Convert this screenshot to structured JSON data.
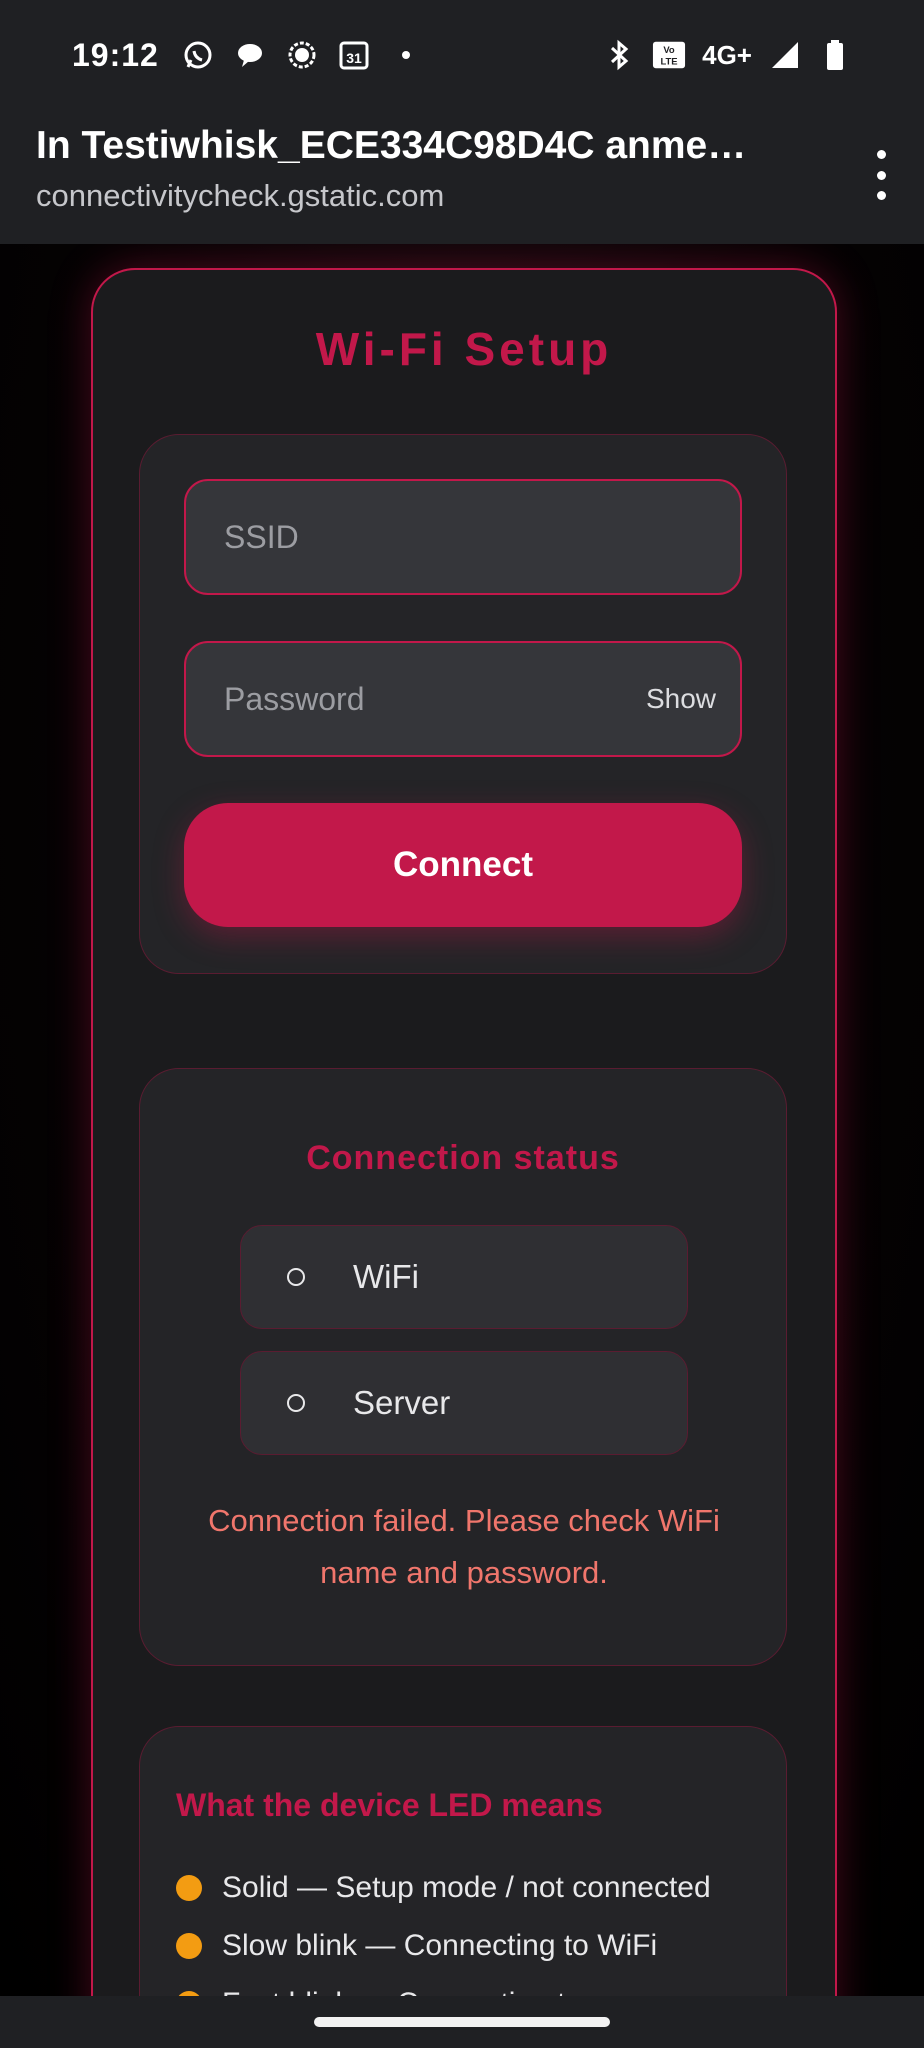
{
  "status_bar": {
    "time": "19:12",
    "network": "4G+",
    "icons_left": [
      "whatsapp-icon",
      "chat-bubble-icon",
      "signal-app-icon",
      "calendar-icon",
      "dot-icon"
    ],
    "calendar_day": "31",
    "volte": "Vo LTE",
    "icons_right": [
      "bluetooth-icon",
      "volte-icon",
      "cell-signal-icon",
      "battery-icon"
    ]
  },
  "browser": {
    "page_title": "In Testiwhisk_ECE334C98D4C anme…",
    "host": "connectivitycheck.gstatic.com"
  },
  "setup": {
    "title": "Wi-Fi Setup",
    "ssid_placeholder": "SSID",
    "ssid_value": "",
    "password_placeholder": "Password",
    "password_value": "",
    "show_label": "Show",
    "connect_label": "Connect"
  },
  "status": {
    "title": "Connection status",
    "items": [
      {
        "label": "WiFi",
        "state": "idle"
      },
      {
        "label": "Server",
        "state": "idle"
      }
    ],
    "message": "Connection failed. Please check WiFi name and password."
  },
  "led": {
    "title": "What the device LED means",
    "items": [
      {
        "text": "Solid — Setup mode / not connected",
        "color": "#f39c12"
      },
      {
        "text": "Slow blink — Connecting to WiFi",
        "color": "#f39c12"
      },
      {
        "text": "Fast blink — Connecting to server",
        "color": "#f39c12"
      }
    ]
  },
  "colors": {
    "accent": "#c2184a",
    "error": "#f0766c",
    "led": "#f39c12"
  }
}
